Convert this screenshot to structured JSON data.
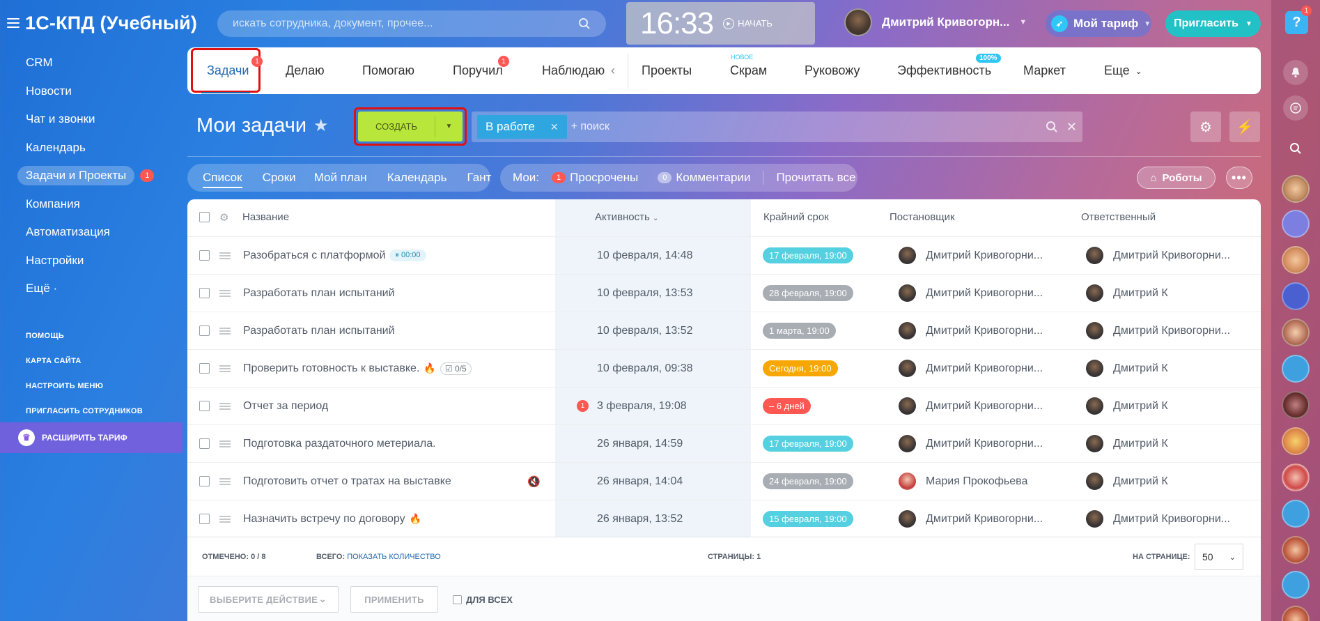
{
  "app": {
    "title": "1С-КПД (Учебный)"
  },
  "search": {
    "placeholder": "искать сотрудника, документ, прочее..."
  },
  "clock": {
    "time": "16:33",
    "start_label": "НАЧАТЬ"
  },
  "user": {
    "name": "Дмитрий Кривогорн..."
  },
  "tariff": {
    "label": "Мой тариф"
  },
  "invite": {
    "label": "Пригласить"
  },
  "help": {
    "icon": "?",
    "badge": "1"
  },
  "sidebar": {
    "items": [
      {
        "label": "CRM"
      },
      {
        "label": "Новости"
      },
      {
        "label": "Чат и звонки"
      },
      {
        "label": "Календарь"
      },
      {
        "label": "Задачи и Проекты",
        "badge": "1"
      },
      {
        "label": "Компания"
      },
      {
        "label": "Автоматизация"
      },
      {
        "label": "Настройки"
      },
      {
        "label": "Ещё ·"
      }
    ],
    "links": [
      "ПОМОЩЬ",
      "КАРТА САЙТА",
      "НАСТРОИТЬ МЕНЮ",
      "ПРИГЛАСИТЬ СОТРУДНИКОВ"
    ],
    "upgrade": "РАСШИРИТЬ ТАРИФ"
  },
  "tabs": {
    "zadachi": "Задачи",
    "zadachi_badge": "1",
    "delayu": "Делаю",
    "pomogayu": "Помогаю",
    "poruchil": "Поручил",
    "poruchil_badge": "1",
    "nablyudayu": "Наблюдаю",
    "proekty": "Проекты",
    "skram": "Скрам",
    "skram_tag": "НОВОЕ",
    "rukovozhu": "Руковожу",
    "effektivnost": "Эффективность",
    "effektivnost_tag": "100%",
    "market": "Маркет",
    "eshche": "Еще"
  },
  "header": {
    "title": "Мои задачи",
    "create_label": "СОЗДАТЬ",
    "filter_chip": "В работе",
    "filter_placeholder": "+ поиск"
  },
  "views": {
    "items": [
      "Список",
      "Сроки",
      "Мой план",
      "Календарь",
      "Гант"
    ],
    "my_label": "Мои:",
    "overdue_count": "1",
    "overdue_label": "Просрочены",
    "comments_count": "0",
    "comments_label": "Комментарии",
    "read_all": "Прочитать все",
    "robots": "Роботы"
  },
  "table": {
    "columns": {
      "name": "Название",
      "activity": "Активность",
      "deadline": "Крайний срок",
      "creator": "Постановщик",
      "responsible": "Ответственный"
    },
    "rows": [
      {
        "name": "Разобраться с платформой",
        "timer": "00:00",
        "activity": "10 февраля, 14:48",
        "deadline": "17 февраля, 19:00",
        "deadline_color": "#55d0e0",
        "creator": "Дмитрий Кривогорни...",
        "responsible": "Дмитрий Кривогорни..."
      },
      {
        "name": "Разработать план испытаний",
        "activity": "10 февраля, 13:53",
        "deadline": "28 февраля, 19:00",
        "deadline_color": "#a8adb4",
        "creator": "Дмитрий Кривогорни...",
        "responsible": "Дмитрий К"
      },
      {
        "name": "Разработать план испытаний",
        "activity": "10 февраля, 13:52",
        "deadline": "1 марта, 19:00",
        "deadline_color": "#a8adb4",
        "creator": "Дмитрий Кривогорни...",
        "responsible": "Дмитрий Кривогорни..."
      },
      {
        "name": "Проверить готовность к выставке.",
        "fire": true,
        "checklist": "0/5",
        "activity": "10 февраля, 09:38",
        "deadline": "Сегодня, 19:00",
        "deadline_color": "#f7a700",
        "creator": "Дмитрий Кривогорни...",
        "responsible": "Дмитрий К"
      },
      {
        "name": "Отчет за период",
        "activity_badge": "1",
        "activity": "3 февраля, 19:08",
        "deadline": "– 6 дней",
        "deadline_color": "#ff5752",
        "creator": "Дмитрий Кривогорни...",
        "responsible": "Дмитрий К"
      },
      {
        "name": "Подготовка раздаточного метериала.",
        "activity": "26 января, 14:59",
        "deadline": "17 февраля, 19:00",
        "deadline_color": "#55d0e0",
        "creator": "Дмитрий Кривогорни...",
        "responsible": "Дмитрий К"
      },
      {
        "name": "Подготовить отчет о тратах на выставке",
        "muted": true,
        "activity": "26 января, 14:04",
        "deadline": "24 февраля, 19:00",
        "deadline_color": "#a8adb4",
        "creator": "Мария Прокофьева",
        "responsible": "Дмитрий К"
      },
      {
        "name": "Назначить встречу по договору",
        "fire": true,
        "activity": "26 января, 13:52",
        "deadline": "15 февраля, 19:00",
        "deadline_color": "#55d0e0",
        "creator": "Дмитрий Кривогорни...",
        "responsible": "Дмитрий Кривогорни..."
      }
    ]
  },
  "footer": {
    "checked_label": "ОТМЕЧЕНО:",
    "checked_value": "0 / 8",
    "total_label": "ВСЕГО:",
    "total_link": "ПОКАЗАТЬ КОЛИЧЕСТВО",
    "pages_label": "СТРАНИЦЫ:",
    "pages_value": "1",
    "per_page_label": "НА СТРАНИЦЕ:",
    "per_page_value": "50",
    "action_select": "ВЫБЕРИТЕ ДЕЙСТВИЕ",
    "apply": "ПРИМЕНИТЬ",
    "for_all": "ДЛЯ ВСЕХ"
  }
}
